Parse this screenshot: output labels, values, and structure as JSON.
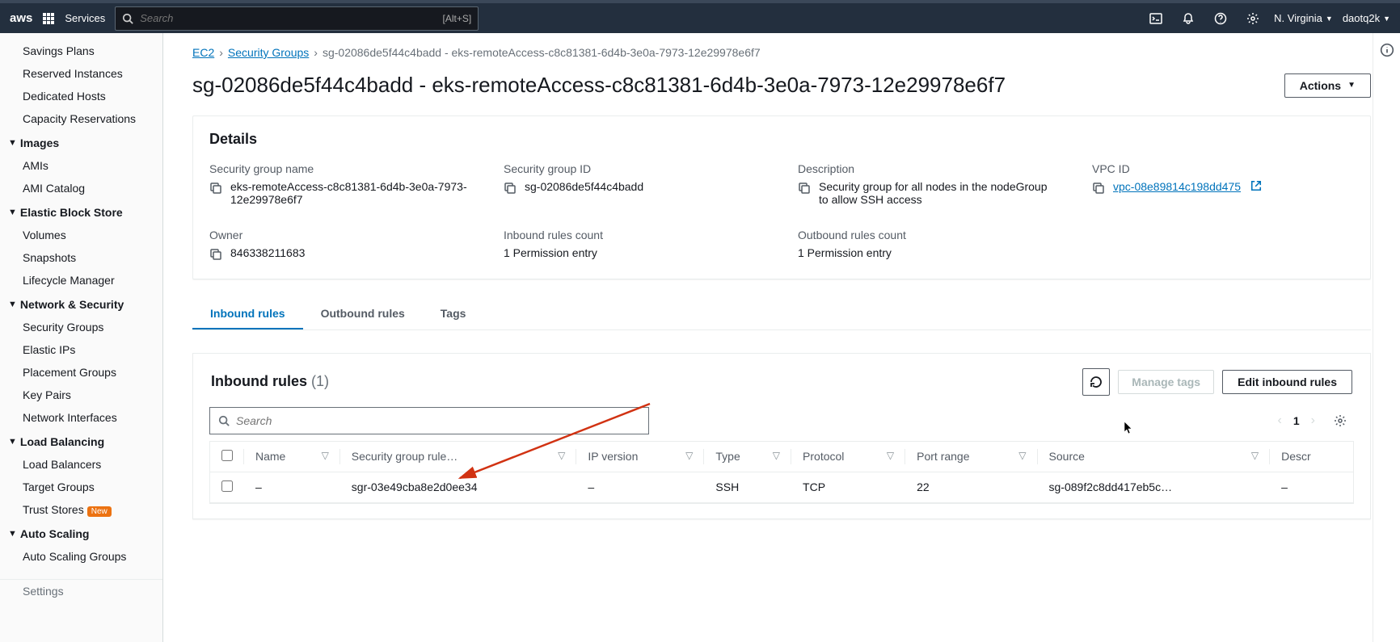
{
  "topbar": {
    "logo": "aws",
    "services": "Services",
    "search_placeholder": "Search",
    "search_shortcut": "[Alt+S]",
    "region": "N. Virginia",
    "user": "daotq2k"
  },
  "sidebar": {
    "top_items": [
      "Savings Plans",
      "Reserved Instances",
      "Dedicated Hosts",
      "Capacity Reservations"
    ],
    "groups": [
      {
        "name": "Images",
        "items": [
          "AMIs",
          "AMI Catalog"
        ]
      },
      {
        "name": "Elastic Block Store",
        "items": [
          "Volumes",
          "Snapshots",
          "Lifecycle Manager"
        ]
      },
      {
        "name": "Network & Security",
        "items": [
          "Security Groups",
          "Elastic IPs",
          "Placement Groups",
          "Key Pairs",
          "Network Interfaces"
        ]
      },
      {
        "name": "Load Balancing",
        "items": [
          "Load Balancers",
          "Target Groups",
          "Trust Stores"
        ]
      },
      {
        "name": "Auto Scaling",
        "items": [
          "Auto Scaling Groups"
        ]
      }
    ],
    "new_badge_on": "Trust Stores",
    "bottom_item": "Settings"
  },
  "breadcrumb": {
    "ec2": "EC2",
    "sg": "Security Groups",
    "current": "sg-02086de5f44c4badd - eks-remoteAccess-c8c81381-6d4b-3e0a-7973-12e29978e6f7"
  },
  "title": "sg-02086de5f44c4badd - eks-remoteAccess-c8c81381-6d4b-3e0a-7973-12e29978e6f7",
  "actions_btn": "Actions",
  "details": {
    "heading": "Details",
    "fields": {
      "sg_name": {
        "label": "Security group name",
        "value": "eks-remoteAccess-c8c81381-6d4b-3e0a-7973-12e29978e6f7"
      },
      "sg_id": {
        "label": "Security group ID",
        "value": "sg-02086de5f44c4badd"
      },
      "desc": {
        "label": "Description",
        "value": "Security group for all nodes in the nodeGroup to allow SSH access"
      },
      "vpc": {
        "label": "VPC ID",
        "value": "vpc-08e89814c198dd475"
      },
      "owner": {
        "label": "Owner",
        "value": "846338211683"
      },
      "inbound": {
        "label": "Inbound rules count",
        "value": "1 Permission entry"
      },
      "outbound": {
        "label": "Outbound rules count",
        "value": "1 Permission entry"
      }
    }
  },
  "tabs": {
    "inbound": "Inbound rules",
    "outbound": "Outbound rules",
    "tags": "Tags"
  },
  "rules_panel": {
    "heading": "Inbound rules",
    "count": "(1)",
    "manage_tags": "Manage tags",
    "edit": "Edit inbound rules",
    "search_placeholder": "Search",
    "page": "1",
    "columns": [
      "Name",
      "Security group rule…",
      "IP version",
      "Type",
      "Protocol",
      "Port range",
      "Source",
      "Descr"
    ],
    "rows": [
      {
        "name": "–",
        "sgr": "sgr-03e49cba8e2d0ee34",
        "ipv": "–",
        "type": "SSH",
        "proto": "TCP",
        "port": "22",
        "source": "sg-089f2c8dd417eb5c…",
        "desc": "–"
      }
    ]
  }
}
